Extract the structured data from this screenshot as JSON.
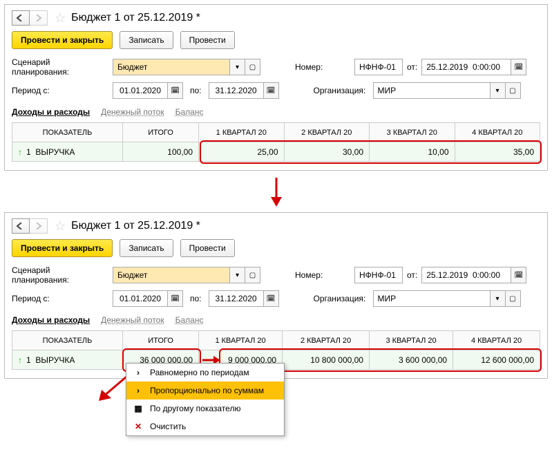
{
  "shared": {
    "title": "Бюджет 1 от 25.12.2019 *",
    "buttons": {
      "postClose": "Провести и закрыть",
      "save": "Записать",
      "post": "Провести"
    },
    "scenarioLabel": "Сценарий планирования:",
    "scenarioValue": "Бюджет",
    "periodLabel": "Период с:",
    "periodFrom": "01.01.2020",
    "periodToLabel": "по:",
    "periodTo": "31.12.2020",
    "numberLabel": "Номер:",
    "numberValue": "НФНФ-01",
    "fromLabel": "от:",
    "dateValue": "25.12.2019  0:00:00",
    "orgLabel": "Организация:",
    "orgValue": "МИР",
    "tabs": {
      "t1": "Доходы и расходы",
      "t2": "Денежный поток",
      "t3": "Баланс"
    },
    "cols": {
      "c0": "ПОКАЗАТЕЛЬ",
      "c1": "ИТОГО",
      "c2": "1 КВАРТАЛ 20",
      "c3": "2 КВАРТАЛ 20",
      "c4": "3 КВАРТАЛ 20",
      "c5": "4 КВАРТАЛ 20"
    },
    "indicatorNum": "1",
    "indicatorName": "ВЫРУЧКА"
  },
  "panel1": {
    "total": "100,00",
    "q1": "25,00",
    "q2": "30,00",
    "q3": "10,00",
    "q4": "35,00"
  },
  "panel2": {
    "total": "36 000 000,00",
    "q1": "9 000 000,00",
    "q2": "10 800 000,00",
    "q3": "3 600 000,00",
    "q4": "12 600 000,00"
  },
  "menu": {
    "m1": "Равномерно по периодам",
    "m2": "Пропорционально по суммам",
    "m3": "По другому показателю",
    "m4": "Очистить"
  }
}
